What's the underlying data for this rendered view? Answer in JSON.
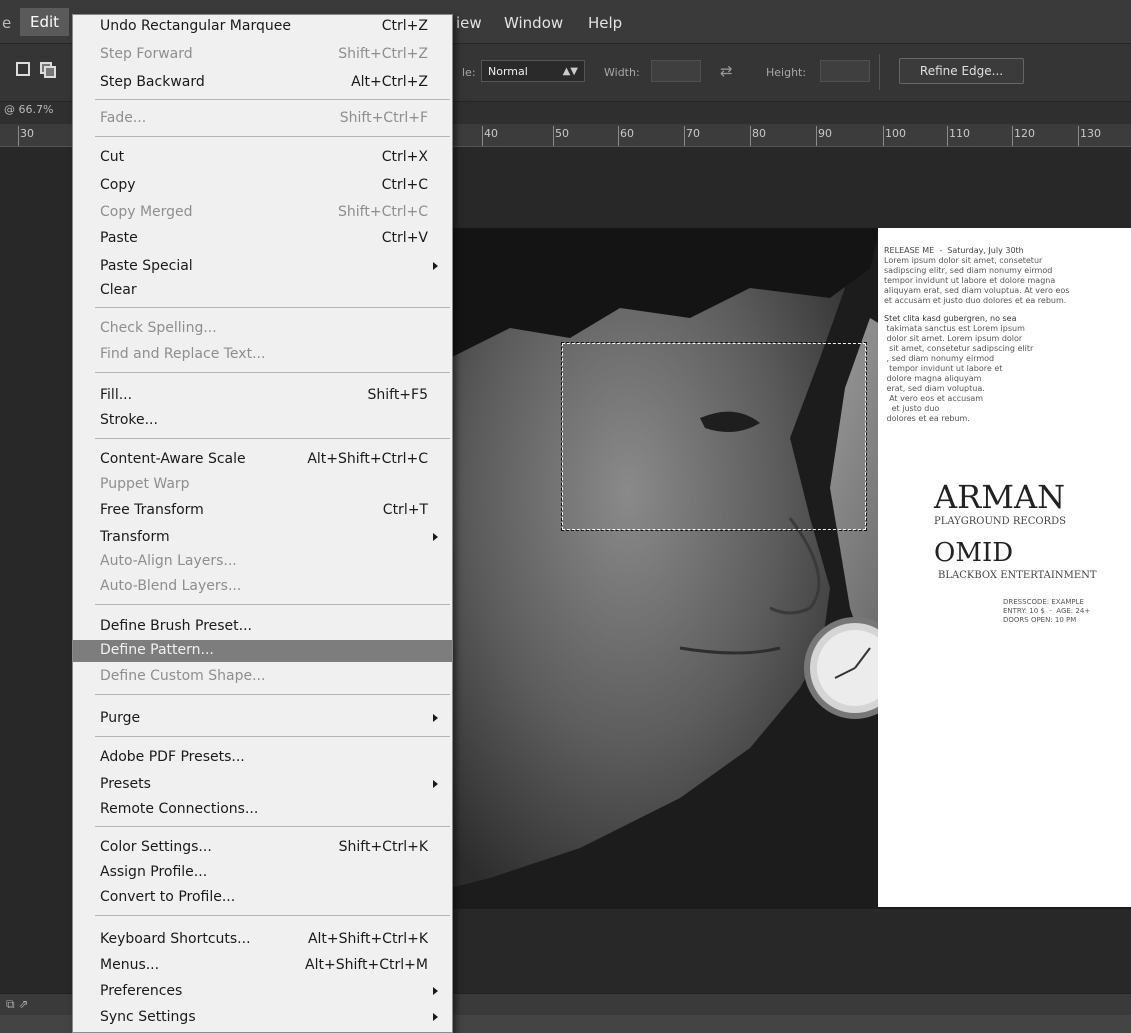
{
  "menubar": {
    "stub": "e",
    "active": "Edit",
    "items": [
      "View",
      "Window",
      "Help"
    ],
    "view_visible": "iew"
  },
  "options_bar": {
    "style_label": "le:",
    "style_value": "Normal",
    "width_label": "Width:",
    "height_label": "Height:",
    "refine_edge": "Refine Edge..."
  },
  "document": {
    "zoom": "@ 66.7%"
  },
  "ruler": {
    "labels": [
      "30",
      "40",
      "50",
      "60",
      "70",
      "80",
      "90",
      "100",
      "110",
      "120",
      "130"
    ]
  },
  "flyer": {
    "release": "RELEASE ME  -  Saturday, July 30th",
    "para1": [
      "Lorem ipsum dolor sit amet, consetetur",
      "sadipscing elitr, sed diam nonumy eirmod",
      "tempor invidunt ut labore et dolore magna",
      "aliquyam erat, sed diam voluptua. At vero eos",
      "et accusam et justo duo dolores et ea rebum."
    ],
    "para2": [
      "Stet clita kasd gubergren, no sea",
      " takimata sanctus est Lorem ipsum",
      " dolor sit amet. Lorem ipsum dolor",
      "  sit amet, consetetur sadipscing elitr",
      " , sed diam nonumy eirmod",
      "  tempor invidunt ut labore et",
      " dolore magna aliquyam",
      " erat, sed diam voluptua.",
      "  At vero eos et accusam",
      "   et justo duo",
      " dolores et ea rebum."
    ],
    "artist1": "ARMAN",
    "label1": "PLAYGROUND RECORDS",
    "artist2": "OMID",
    "label2": "BLACKBOX ENTERTAINMENT",
    "info": [
      "DRESSCODE: EXAMPLE",
      "ENTRY: 10 $  -  AGE: 24+",
      "DOORS OPEN: 10 PM"
    ]
  },
  "edit_menu": {
    "items": [
      {
        "label": "Undo Rectangular Marquee",
        "shortcut": "Ctrl+Z",
        "disabled": false
      },
      {
        "label": "Step Forward",
        "shortcut": "Shift+Ctrl+Z",
        "disabled": true
      },
      {
        "label": "Step Backward",
        "shortcut": "Alt+Ctrl+Z",
        "disabled": false
      },
      {
        "label": "Fade...",
        "shortcut": "Shift+Ctrl+F",
        "disabled": true
      },
      {
        "label": "Cut",
        "shortcut": "Ctrl+X",
        "disabled": false
      },
      {
        "label": "Copy",
        "shortcut": "Ctrl+C",
        "disabled": false
      },
      {
        "label": "Copy Merged",
        "shortcut": "Shift+Ctrl+C",
        "disabled": true
      },
      {
        "label": "Paste",
        "shortcut": "Ctrl+V",
        "disabled": false
      },
      {
        "label": "Paste Special",
        "shortcut": "",
        "disabled": false,
        "submenu": true
      },
      {
        "label": "Clear",
        "shortcut": "",
        "disabled": false
      },
      {
        "label": "Check Spelling...",
        "shortcut": "",
        "disabled": true
      },
      {
        "label": "Find and Replace Text...",
        "shortcut": "",
        "disabled": true
      },
      {
        "label": "Fill...",
        "shortcut": "Shift+F5",
        "disabled": false
      },
      {
        "label": "Stroke...",
        "shortcut": "",
        "disabled": false
      },
      {
        "label": "Content-Aware Scale",
        "shortcut": "Alt+Shift+Ctrl+C",
        "disabled": false
      },
      {
        "label": "Puppet Warp",
        "shortcut": "",
        "disabled": true
      },
      {
        "label": "Free Transform",
        "shortcut": "Ctrl+T",
        "disabled": false
      },
      {
        "label": "Transform",
        "shortcut": "",
        "disabled": false,
        "submenu": true
      },
      {
        "label": "Auto-Align Layers...",
        "shortcut": "",
        "disabled": true
      },
      {
        "label": "Auto-Blend Layers...",
        "shortcut": "",
        "disabled": true
      },
      {
        "label": "Define Brush Preset...",
        "shortcut": "",
        "disabled": false
      },
      {
        "label": "Define Pattern...",
        "shortcut": "",
        "disabled": false,
        "highlighted": true
      },
      {
        "label": "Define Custom Shape...",
        "shortcut": "",
        "disabled": true
      },
      {
        "label": "Purge",
        "shortcut": "",
        "disabled": false,
        "submenu": true
      },
      {
        "label": "Adobe PDF Presets...",
        "shortcut": "",
        "disabled": false
      },
      {
        "label": "Presets",
        "shortcut": "",
        "disabled": false,
        "submenu": true
      },
      {
        "label": "Remote Connections...",
        "shortcut": "",
        "disabled": false
      },
      {
        "label": "Color Settings...",
        "shortcut": "Shift+Ctrl+K",
        "disabled": false
      },
      {
        "label": "Assign Profile...",
        "shortcut": "",
        "disabled": false
      },
      {
        "label": "Convert to Profile...",
        "shortcut": "",
        "disabled": false
      },
      {
        "label": "Keyboard Shortcuts...",
        "shortcut": "Alt+Shift+Ctrl+K",
        "disabled": false
      },
      {
        "label": "Menus...",
        "shortcut": "Alt+Shift+Ctrl+M",
        "disabled": false
      },
      {
        "label": "Preferences",
        "shortcut": "",
        "disabled": false,
        "submenu": true
      },
      {
        "label": "Sync Settings",
        "shortcut": "",
        "disabled": false,
        "submenu": true
      }
    ]
  }
}
